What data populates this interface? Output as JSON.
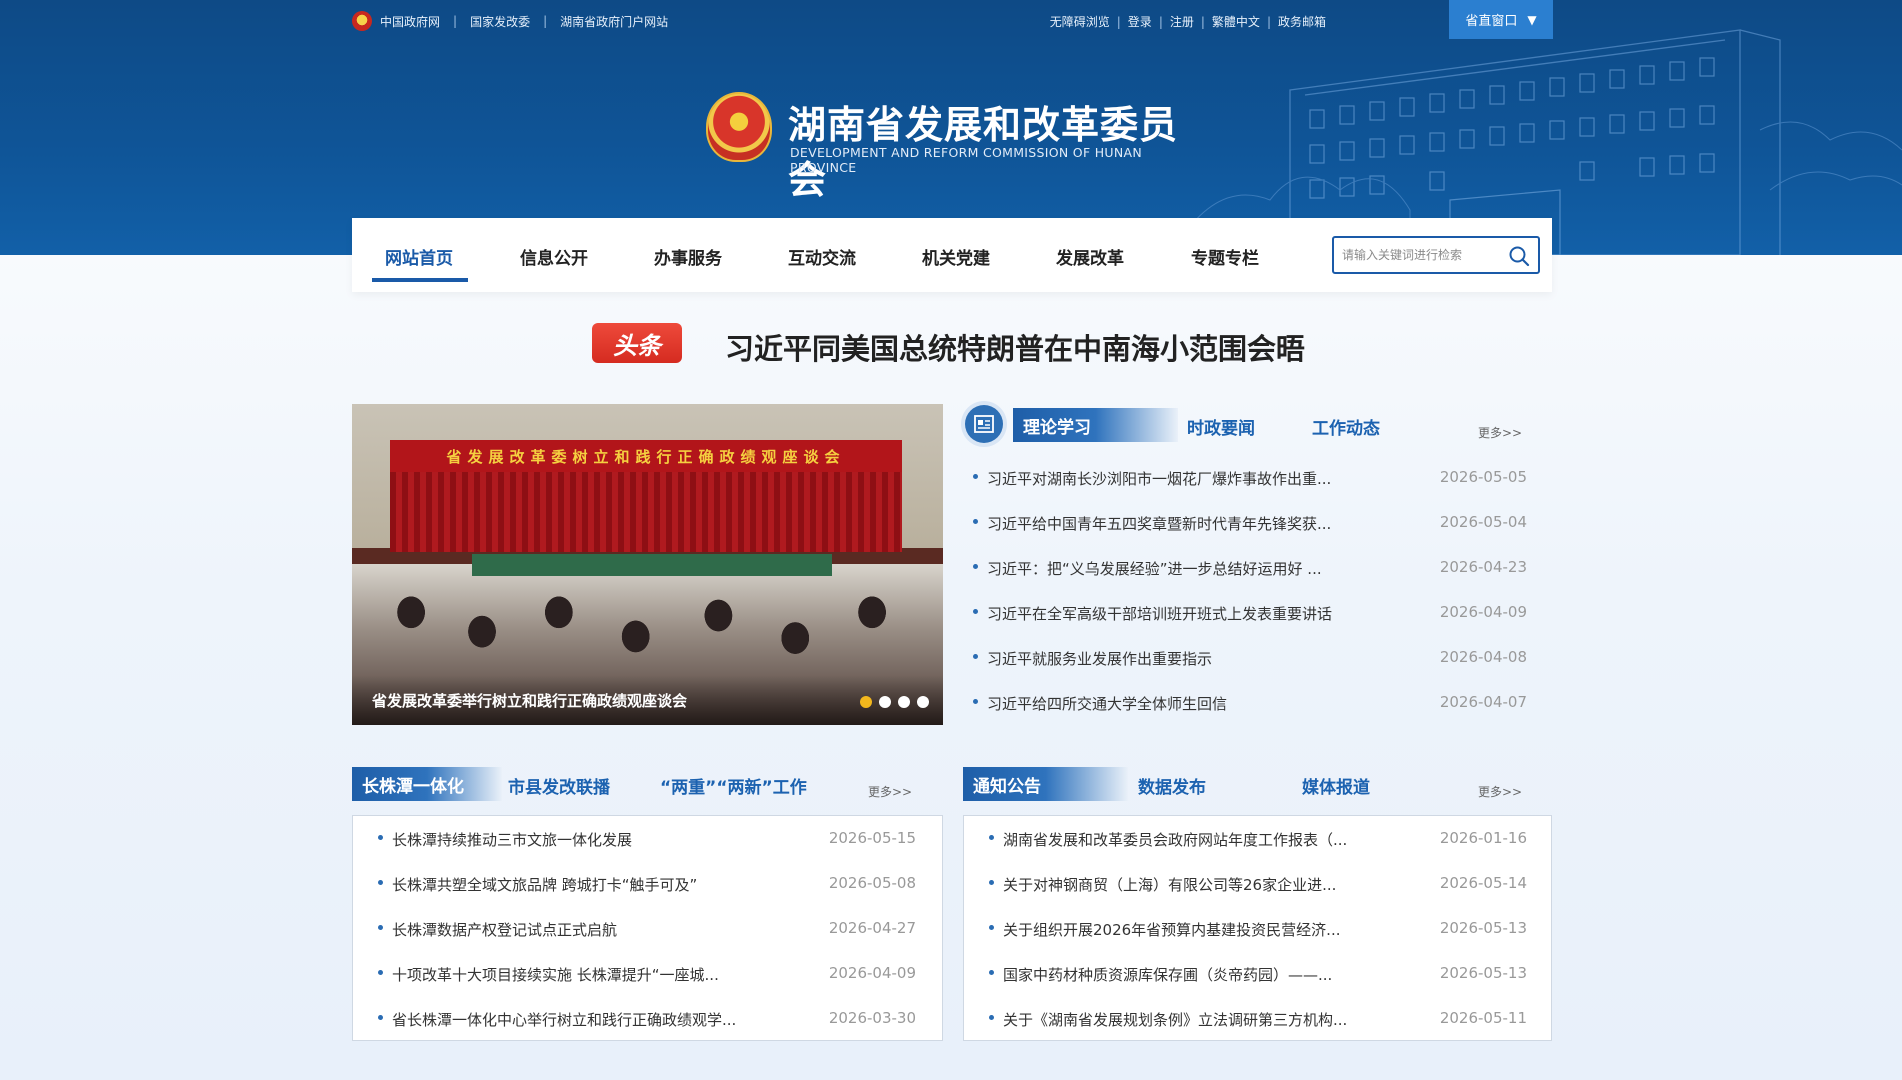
{
  "topbar": {
    "left_links": [
      "中国政府网",
      "国家发改委",
      "湖南省政府门户网站"
    ],
    "right_links": [
      "无障碍浏览",
      "登录",
      "注册",
      "繁體中文",
      "政务邮箱"
    ],
    "gov_window": "省直窗口",
    "gov_window_arrow": "▼"
  },
  "logo": {
    "title": "湖南省发展和改革委员会",
    "subtitle": "DEVELOPMENT AND REFORM COMMISSION OF HUNAN PROVINCE"
  },
  "nav": {
    "items": [
      "网站首页",
      "信息公开",
      "办事服务",
      "互动交流",
      "机关党建",
      "发展改革",
      "专题专栏"
    ],
    "active_index": 0,
    "search_placeholder": "请输入关键词进行检索"
  },
  "headline": {
    "badge": "头条",
    "text": "习近平同美国总统特朗普在中南海小范围会晤"
  },
  "slideshow": {
    "banner_text": "省发展改革委树立和践行正确政绩观座谈会",
    "caption": "省发展改革委举行树立和践行正确政绩观座谈会",
    "slide_count": 4,
    "active_slide": 1
  },
  "panel_theory": {
    "tabs": [
      "理论学习",
      "时政要闻",
      "工作动态"
    ],
    "more": "更多>>",
    "items": [
      {
        "title": "习近平对湖南长沙浏阳市一烟花厂爆炸事故作出重...",
        "date": "2026-05-05"
      },
      {
        "title": "习近平给中国青年五四奖章暨新时代青年先锋奖获...",
        "date": "2026-05-04"
      },
      {
        "title": "习近平：把“义乌发展经验”进一步总结好运用好 ...",
        "date": "2026-04-23"
      },
      {
        "title": "习近平在全军高级干部培训班开班式上发表重要讲话",
        "date": "2026-04-09"
      },
      {
        "title": "习近平就服务业发展作出重要指示",
        "date": "2026-04-08"
      },
      {
        "title": "习近平给四所交通大学全体师生回信",
        "date": "2026-04-07"
      }
    ]
  },
  "panel_czt": {
    "tabs": [
      "长株潭一体化",
      "市县发改联播",
      "“两重”“两新”工作"
    ],
    "more": "更多>>",
    "items": [
      {
        "title": "长株潭持续推动三市文旅一体化发展",
        "date": "2026-05-15"
      },
      {
        "title": "长株潭共塑全域文旅品牌 跨城打卡“触手可及”",
        "date": "2026-05-08"
      },
      {
        "title": "长株潭数据产权登记试点正式启航",
        "date": "2026-04-27"
      },
      {
        "title": "十项改革十大项目接续实施 长株潭提升“一座城...",
        "date": "2026-04-09"
      },
      {
        "title": "省长株潭一体化中心举行树立和践行正确政绩观学...",
        "date": "2026-03-30"
      }
    ]
  },
  "panel_notice": {
    "tabs": [
      "通知公告",
      "数据发布",
      "媒体报道"
    ],
    "more": "更多>>",
    "items": [
      {
        "title": "湖南省发展和改革委员会政府网站年度工作报表（...",
        "date": "2026-01-16"
      },
      {
        "title": "关于对神钢商贸（上海）有限公司等26家企业进...",
        "date": "2026-05-14"
      },
      {
        "title": "关于组织开展2026年省预算内基建投资民营经济...",
        "date": "2026-05-13"
      },
      {
        "title": "国家中药材种质资源库保存圃（炎帝药园）——...",
        "date": "2026-05-13"
      },
      {
        "title": "关于《湖南省发展规划条例》立法调研第三方机构...",
        "date": "2026-05-11"
      }
    ]
  },
  "colors": {
    "header_blue": "#0f5598",
    "accent_blue": "#1a5aa8",
    "headline_red": "#e33a2e",
    "dot_active": "#f2b71d"
  }
}
